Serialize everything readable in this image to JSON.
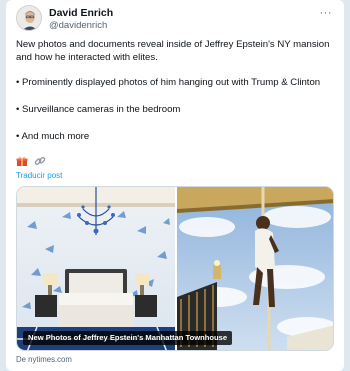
{
  "author": {
    "name": "David Enrich",
    "handle": "@davidenrich"
  },
  "more_label": "···",
  "post": {
    "paragraphs": [
      "New photos and documents reveal inside of Jeffrey Epstein's NY mansion and how he interacted with elites.",
      "• Prominently displayed photos of him hanging out with Trump & Clinton",
      "• Surveillance cameras in the bedroom",
      "• And much more"
    ]
  },
  "emojis": [
    "gift-icon",
    "link-icon"
  ],
  "translate_label": "Traducir post",
  "media": {
    "card_caption": "New Photos of Jeffrey Epstein's Manhattan Townhouse",
    "images": [
      "bedroom-photo",
      "staircase-figure-photo"
    ]
  },
  "source_label": "De nytimes.com",
  "colors": {
    "link": "#1d9bf0",
    "secondary_text": "#536471",
    "background": "#dfe7ef"
  }
}
